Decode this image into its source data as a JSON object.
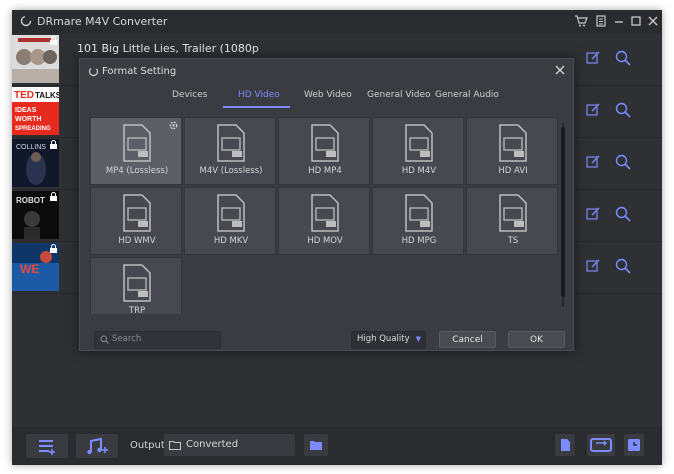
{
  "app": {
    "title": "DRmare M4V Converter"
  },
  "titlebar": {
    "icons": [
      "cart-icon",
      "register-icon",
      "menu-icon",
      "minimize-icon",
      "maximize-icon",
      "close-icon"
    ]
  },
  "list": {
    "first_title": "101 Big Little Lies, Trailer (1080p",
    "thumbs": [
      {
        "color": "#c7c7c7",
        "overlay": "",
        "bg": "#e9e9e9"
      },
      {
        "color": "#ffffff",
        "overlay": "TED TALKS",
        "bg": "#e6262d",
        "overlay2": "IDEAS WORTH SPREADING"
      },
      {
        "color": "#1b2540",
        "overlay": "COLLINS",
        "bg": "#11182a"
      },
      {
        "color": "#101010",
        "overlay": "ROBOT",
        "bg": "#0c0c0c"
      },
      {
        "color": "#0a1f3c",
        "overlay": "WE",
        "bg": "#0e3767"
      }
    ]
  },
  "dialog": {
    "title": "Format Setting",
    "tabs": [
      "Devices",
      "HD Video",
      "Web Video",
      "General Video",
      "General Audio"
    ],
    "active_tab": "HD Video",
    "formats": [
      "MP4 (Lossless)",
      "M4V (Lossless)",
      "HD MP4",
      "HD M4V",
      "HD AVI",
      "HD WMV",
      "HD MKV",
      "HD MOV",
      "HD MPG",
      "TS",
      "TRP"
    ],
    "selected": "MP4 (Lossless)",
    "search_placeholder": "Search",
    "quality": "High Quality",
    "cancel": "Cancel",
    "ok": "OK"
  },
  "bottom": {
    "output_label": "Output:",
    "output_value": "Converted"
  },
  "colors": {
    "accent": "#7d8bff",
    "bg": "#2d2e32"
  }
}
